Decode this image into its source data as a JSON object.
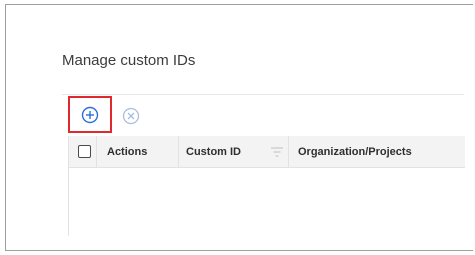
{
  "section": {
    "title": "Manage custom IDs"
  },
  "toolbar": {
    "add_icon": "plus-circle-icon",
    "remove_icon": "x-circle-icon",
    "add_highlight_color": "#e0282e",
    "add_icon_color": "#2a6fd6",
    "remove_icon_color": "#a9bde0"
  },
  "table": {
    "columns": [
      {
        "key": "select",
        "label": ""
      },
      {
        "key": "actions",
        "label": "Actions"
      },
      {
        "key": "custom_id",
        "label": "Custom ID"
      },
      {
        "key": "org_projects",
        "label": "Organization/Projects"
      }
    ],
    "header_background": "#f3f3f3",
    "filter_icon": "filter-icon",
    "rows": []
  }
}
